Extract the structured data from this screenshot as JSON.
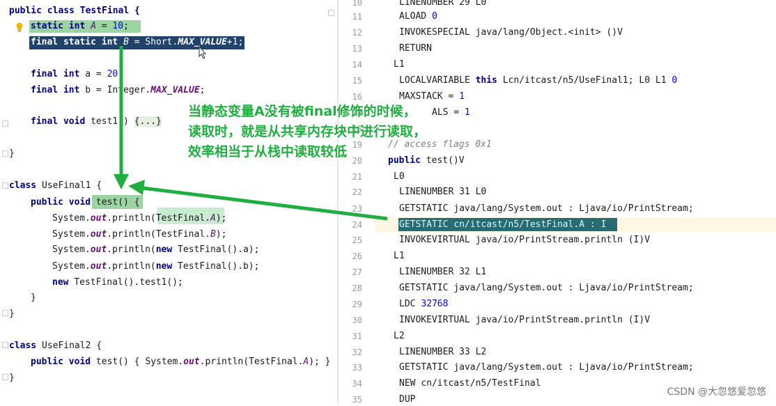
{
  "colors": {
    "annotation": "#1fae3f",
    "selection": "#20426b",
    "highlight": "#9bd3a3"
  },
  "left_code": {
    "l01": [
      "public class TestFinal {"
    ],
    "l02": [
      "static int ",
      "A",
      " = ",
      "10",
      ";"
    ],
    "l03": [
      "final static int ",
      "B",
      " = Short.",
      "MAX_VALUE",
      "+1;"
    ],
    "l04": [
      "final int ",
      "a",
      " = ",
      "20"
    ],
    "l05": [
      "final int ",
      "b",
      " = Integer.",
      "MAX_VALUE",
      ";"
    ],
    "l06": [
      "final void ",
      "test1() ",
      "{...}"
    ],
    "l07": [
      "}"
    ],
    "l08": [
      "class ",
      "UseFinal1 {"
    ],
    "l09": [
      "public void ",
      "test() {"
    ],
    "l10": [
      "System.",
      "out",
      ".println(TestFinal.",
      "A",
      ");"
    ],
    "l11": [
      "System.",
      "out",
      ".println(TestFinal.",
      "B",
      ");"
    ],
    "l12": [
      "System.",
      "out",
      ".println(",
      "new ",
      "TestFinal().a);"
    ],
    "l13": [
      "System.",
      "out",
      ".println(",
      "new ",
      "TestFinal().b);"
    ],
    "l14": [
      "new ",
      "TestFinal().test1();"
    ],
    "l15": [
      "}"
    ],
    "l16": [
      "}"
    ],
    "l17": [
      "class ",
      "UseFinal2 {"
    ],
    "l18": [
      "public void ",
      "test() { System.",
      "out",
      ".println(TestFinal.",
      "A",
      "); }"
    ],
    "l19": [
      "}"
    ]
  },
  "bytecode": {
    "line_numbers": [
      "10",
      "11",
      "12",
      "13",
      "14",
      "15",
      "16",
      "17",
      "18",
      "19",
      "20",
      "21",
      "22",
      "23",
      "24",
      "25",
      "26",
      "27",
      "28",
      "29",
      "30",
      "31",
      "32",
      "33",
      "34",
      "35"
    ],
    "r10": "LINENUMBER 29 L0",
    "r11": [
      "ALOAD ",
      "0"
    ],
    "r12": "INVOKESPECIAL java/lang/Object.<init> ()V",
    "r13": "RETURN",
    "r14": "L1",
    "r15": [
      "LOCALVARIABLE ",
      "this",
      " Lcn/itcast/n5/UseFinal1; L0 L1 ",
      "0"
    ],
    "r16": [
      "MAXSTACK = ",
      "1"
    ],
    "r17": [
      "ALS = ",
      "1"
    ],
    "r19": "// access flags 0x1",
    "r20": [
      "public ",
      "test()V"
    ],
    "r21": "L0",
    "r22": "LINENUMBER 31 L0",
    "r23": "GETSTATIC java/lang/System.out : Ljava/io/PrintStream;",
    "r24": "GETSTATIC cn/itcast/n5/TestFinal.A : I",
    "r25": "INVOKEVIRTUAL java/io/PrintStream.println (I)V",
    "r26": "L1",
    "r27": "LINENUMBER 32 L1",
    "r28": "GETSTATIC java/lang/System.out : Ljava/io/PrintStream;",
    "r29": [
      "LDC ",
      "32768"
    ],
    "r30": "INVOKEVIRTUAL java/io/PrintStream.println (I)V",
    "r31": "L2",
    "r32": "LINENUMBER 33 L2",
    "r33": "GETSTATIC java/lang/System.out : Ljava/io/PrintStream;",
    "r34": "NEW cn/itcast/n5/TestFinal",
    "r35": "DUP"
  },
  "annotation": {
    "line1": "当静态变量A没有被final修饰的时候，",
    "line2": "读取时，就是从共享内存块中进行读取，",
    "line3": "效率相当于从栈中读取较低"
  },
  "watermark": "CSDN @大忽悠爱忽悠"
}
